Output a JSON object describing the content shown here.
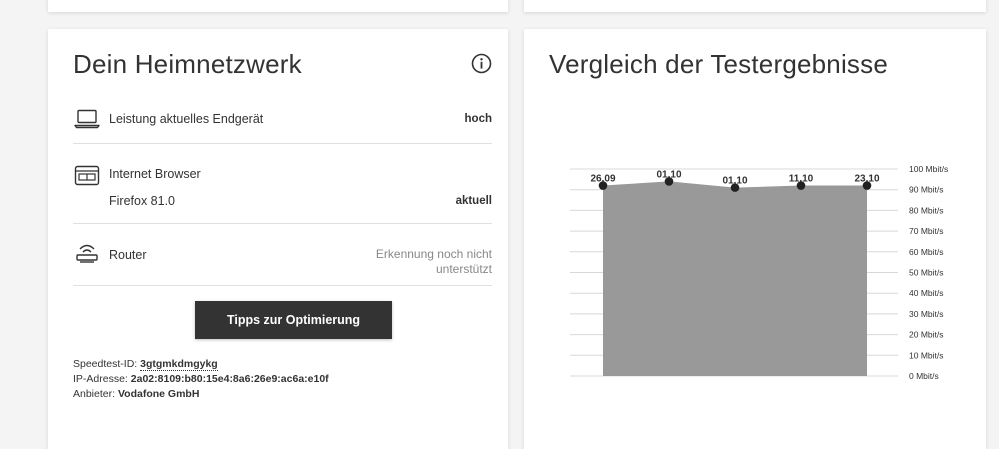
{
  "home_network": {
    "title": "Dein Heimnetzwerk",
    "rows": [
      {
        "icon": "laptop-icon",
        "label": "Leistung aktuelles Endgerät",
        "value": "hoch"
      },
      {
        "icon": "browser-icon",
        "label": "Internet Browser",
        "sub": "Firefox 81.0",
        "value": "aktuell"
      },
      {
        "icon": "router-icon",
        "label": "Router",
        "value_line1": "Erkennung noch nicht",
        "value_line2": "unterstützt"
      }
    ],
    "button_label": "Tipps zur Optimierung",
    "meta": {
      "speedtest_label": "Speedtest-ID:",
      "speedtest_value": "3gtgmkdmgykg",
      "ip_label": "IP-Adresse:",
      "ip_value": "2a02:8109:b80:15e4:8a6:26e9:ac6a:e10f",
      "provider_label": "Anbieter:",
      "provider_value": "Vodafone GmbH"
    }
  },
  "comparison": {
    "title": "Vergleich der Testergebnisse"
  },
  "chart_data": {
    "type": "area",
    "x": [
      "26.09",
      "01.10",
      "01.10",
      "11.10",
      "23.10"
    ],
    "values": [
      92,
      94,
      91,
      92,
      92
    ],
    "ylim": [
      0,
      100
    ],
    "yticks": [
      "0 Mbit/s",
      "10 Mbit/s",
      "20 Mbit/s",
      "30 Mbit/s",
      "40 Mbit/s",
      "50 Mbit/s",
      "60 Mbit/s",
      "70 Mbit/s",
      "80 Mbit/s",
      "90 Mbit/s",
      "100 Mbit/s"
    ],
    "grid": true,
    "fill_color": "#999999",
    "point_color": "#222222"
  }
}
